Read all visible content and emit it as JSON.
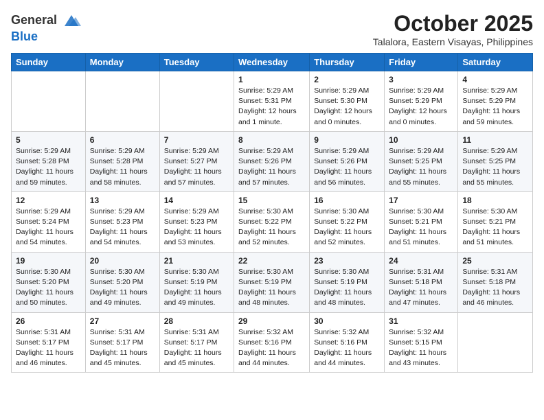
{
  "logo": {
    "general": "General",
    "blue": "Blue"
  },
  "header": {
    "month": "October 2025",
    "location": "Talalora, Eastern Visayas, Philippines"
  },
  "weekdays": [
    "Sunday",
    "Monday",
    "Tuesday",
    "Wednesday",
    "Thursday",
    "Friday",
    "Saturday"
  ],
  "weeks": [
    [
      {
        "day": "",
        "info": ""
      },
      {
        "day": "",
        "info": ""
      },
      {
        "day": "",
        "info": ""
      },
      {
        "day": "1",
        "info": "Sunrise: 5:29 AM\nSunset: 5:31 PM\nDaylight: 12 hours\nand 1 minute."
      },
      {
        "day": "2",
        "info": "Sunrise: 5:29 AM\nSunset: 5:30 PM\nDaylight: 12 hours\nand 0 minutes."
      },
      {
        "day": "3",
        "info": "Sunrise: 5:29 AM\nSunset: 5:29 PM\nDaylight: 12 hours\nand 0 minutes."
      },
      {
        "day": "4",
        "info": "Sunrise: 5:29 AM\nSunset: 5:29 PM\nDaylight: 11 hours\nand 59 minutes."
      }
    ],
    [
      {
        "day": "5",
        "info": "Sunrise: 5:29 AM\nSunset: 5:28 PM\nDaylight: 11 hours\nand 59 minutes."
      },
      {
        "day": "6",
        "info": "Sunrise: 5:29 AM\nSunset: 5:28 PM\nDaylight: 11 hours\nand 58 minutes."
      },
      {
        "day": "7",
        "info": "Sunrise: 5:29 AM\nSunset: 5:27 PM\nDaylight: 11 hours\nand 57 minutes."
      },
      {
        "day": "8",
        "info": "Sunrise: 5:29 AM\nSunset: 5:26 PM\nDaylight: 11 hours\nand 57 minutes."
      },
      {
        "day": "9",
        "info": "Sunrise: 5:29 AM\nSunset: 5:26 PM\nDaylight: 11 hours\nand 56 minutes."
      },
      {
        "day": "10",
        "info": "Sunrise: 5:29 AM\nSunset: 5:25 PM\nDaylight: 11 hours\nand 55 minutes."
      },
      {
        "day": "11",
        "info": "Sunrise: 5:29 AM\nSunset: 5:25 PM\nDaylight: 11 hours\nand 55 minutes."
      }
    ],
    [
      {
        "day": "12",
        "info": "Sunrise: 5:29 AM\nSunset: 5:24 PM\nDaylight: 11 hours\nand 54 minutes."
      },
      {
        "day": "13",
        "info": "Sunrise: 5:29 AM\nSunset: 5:23 PM\nDaylight: 11 hours\nand 54 minutes."
      },
      {
        "day": "14",
        "info": "Sunrise: 5:29 AM\nSunset: 5:23 PM\nDaylight: 11 hours\nand 53 minutes."
      },
      {
        "day": "15",
        "info": "Sunrise: 5:30 AM\nSunset: 5:22 PM\nDaylight: 11 hours\nand 52 minutes."
      },
      {
        "day": "16",
        "info": "Sunrise: 5:30 AM\nSunset: 5:22 PM\nDaylight: 11 hours\nand 52 minutes."
      },
      {
        "day": "17",
        "info": "Sunrise: 5:30 AM\nSunset: 5:21 PM\nDaylight: 11 hours\nand 51 minutes."
      },
      {
        "day": "18",
        "info": "Sunrise: 5:30 AM\nSunset: 5:21 PM\nDaylight: 11 hours\nand 51 minutes."
      }
    ],
    [
      {
        "day": "19",
        "info": "Sunrise: 5:30 AM\nSunset: 5:20 PM\nDaylight: 11 hours\nand 50 minutes."
      },
      {
        "day": "20",
        "info": "Sunrise: 5:30 AM\nSunset: 5:20 PM\nDaylight: 11 hours\nand 49 minutes."
      },
      {
        "day": "21",
        "info": "Sunrise: 5:30 AM\nSunset: 5:19 PM\nDaylight: 11 hours\nand 49 minutes."
      },
      {
        "day": "22",
        "info": "Sunrise: 5:30 AM\nSunset: 5:19 PM\nDaylight: 11 hours\nand 48 minutes."
      },
      {
        "day": "23",
        "info": "Sunrise: 5:30 AM\nSunset: 5:19 PM\nDaylight: 11 hours\nand 48 minutes."
      },
      {
        "day": "24",
        "info": "Sunrise: 5:31 AM\nSunset: 5:18 PM\nDaylight: 11 hours\nand 47 minutes."
      },
      {
        "day": "25",
        "info": "Sunrise: 5:31 AM\nSunset: 5:18 PM\nDaylight: 11 hours\nand 46 minutes."
      }
    ],
    [
      {
        "day": "26",
        "info": "Sunrise: 5:31 AM\nSunset: 5:17 PM\nDaylight: 11 hours\nand 46 minutes."
      },
      {
        "day": "27",
        "info": "Sunrise: 5:31 AM\nSunset: 5:17 PM\nDaylight: 11 hours\nand 45 minutes."
      },
      {
        "day": "28",
        "info": "Sunrise: 5:31 AM\nSunset: 5:17 PM\nDaylight: 11 hours\nand 45 minutes."
      },
      {
        "day": "29",
        "info": "Sunrise: 5:32 AM\nSunset: 5:16 PM\nDaylight: 11 hours\nand 44 minutes."
      },
      {
        "day": "30",
        "info": "Sunrise: 5:32 AM\nSunset: 5:16 PM\nDaylight: 11 hours\nand 44 minutes."
      },
      {
        "day": "31",
        "info": "Sunrise: 5:32 AM\nSunset: 5:15 PM\nDaylight: 11 hours\nand 43 minutes."
      },
      {
        "day": "",
        "info": ""
      }
    ]
  ]
}
